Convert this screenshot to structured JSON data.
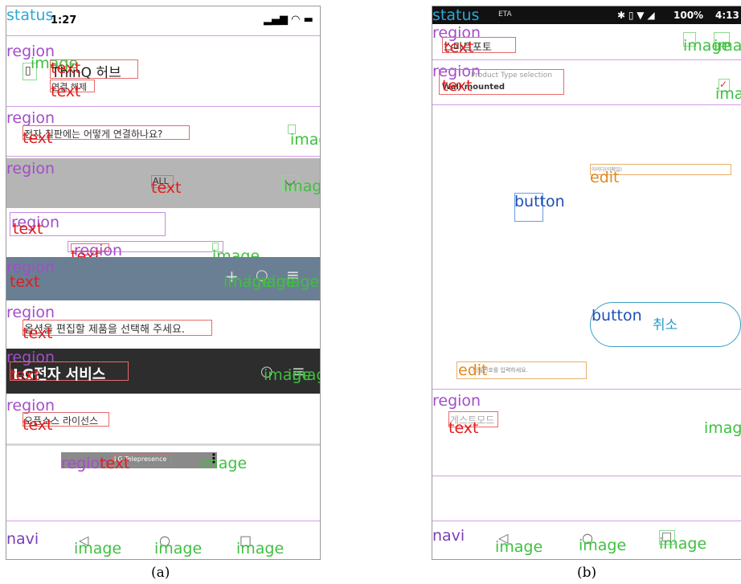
{
  "captions": {
    "a": "(a)",
    "b": "(b)"
  },
  "labels": {
    "status": "status",
    "region": "region",
    "text": "text",
    "image": "image",
    "navi": "navi",
    "button": "button",
    "edit": "edit"
  },
  "panel_a": {
    "time": "1:27",
    "hub_title": "ThinQ 허브",
    "disconnect": "연결 해제",
    "question": "전자 칠판에는 어떻게 연결하나요?",
    "all": "ALL",
    "edit_prompt": "옵션을 편집할 제품을 선택해 주세요.",
    "service_title": "LG전자 서비스",
    "oss": "오픈소스 라이선스",
    "telepresence": "LG Telepresence"
  },
  "panel_b": {
    "status_text": "ETA",
    "battery": "100%",
    "time": "4:13",
    "title": "스마트포토",
    "product_type_placeholder": "Product Type selection",
    "product_type_value": "Wall mounted",
    "id_hint": "아이디(이메일)",
    "cancel": "취소",
    "pw_hint": "비밀번호를 입력하세요.",
    "guest_mode": "게스트모드"
  },
  "colors": {
    "region": "#a34dc9",
    "text": "#e21c1c",
    "image": "#3fbf3f",
    "status": "#2ea7d6",
    "button": "#1f4fb5",
    "edit": "#e2871c",
    "grey_bar": "#b5b5b5",
    "slate_bar": "#6b7f94",
    "dark_bar": "#2d2d2d"
  }
}
